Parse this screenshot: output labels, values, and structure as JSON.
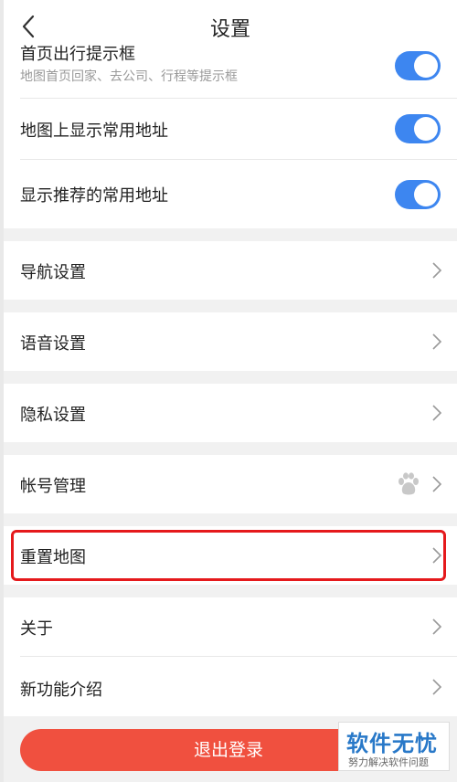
{
  "header": {
    "title": "设置"
  },
  "toggles": [
    {
      "label": "首页出行提示框",
      "sublabel": "地图首页回家、去公司、行程等提示框",
      "on": true
    },
    {
      "label": "地图上显示常用地址",
      "on": true
    },
    {
      "label": "显示推荐的常用地址",
      "on": true
    }
  ],
  "menu": {
    "navigation": "导航设置",
    "voice": "语音设置",
    "privacy": "隐私设置",
    "account": "帐号管理",
    "reset_map": "重置地图",
    "about": "关于",
    "new_features": "新功能介绍"
  },
  "logout_label": "退出登录",
  "watermark": {
    "main": "软件无忧",
    "sub": "努力解决软件问题"
  },
  "colors": {
    "toggle": "#3d86f0",
    "logout": "#f0503f",
    "highlight": "#e5191c"
  }
}
